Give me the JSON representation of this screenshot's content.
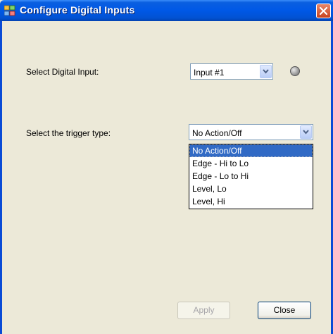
{
  "window": {
    "title": "Configure Digital Inputs"
  },
  "digital_input": {
    "label": "Select Digital Input:",
    "selected": "Input #1",
    "status_led": "off"
  },
  "trigger": {
    "label": "Select the trigger type:",
    "selected": "No Action/Off",
    "options": [
      "No Action/Off",
      "Edge - Hi to Lo",
      "Edge - Lo to Hi",
      "Level, Lo",
      "Level, Hi"
    ]
  },
  "buttons": {
    "apply": "Apply",
    "close": "Close"
  },
  "colors": {
    "titlebar": "#0058E6",
    "dialog_bg": "#ECE9D8",
    "selection": "#316AC5",
    "close_red": "#C8431E"
  }
}
